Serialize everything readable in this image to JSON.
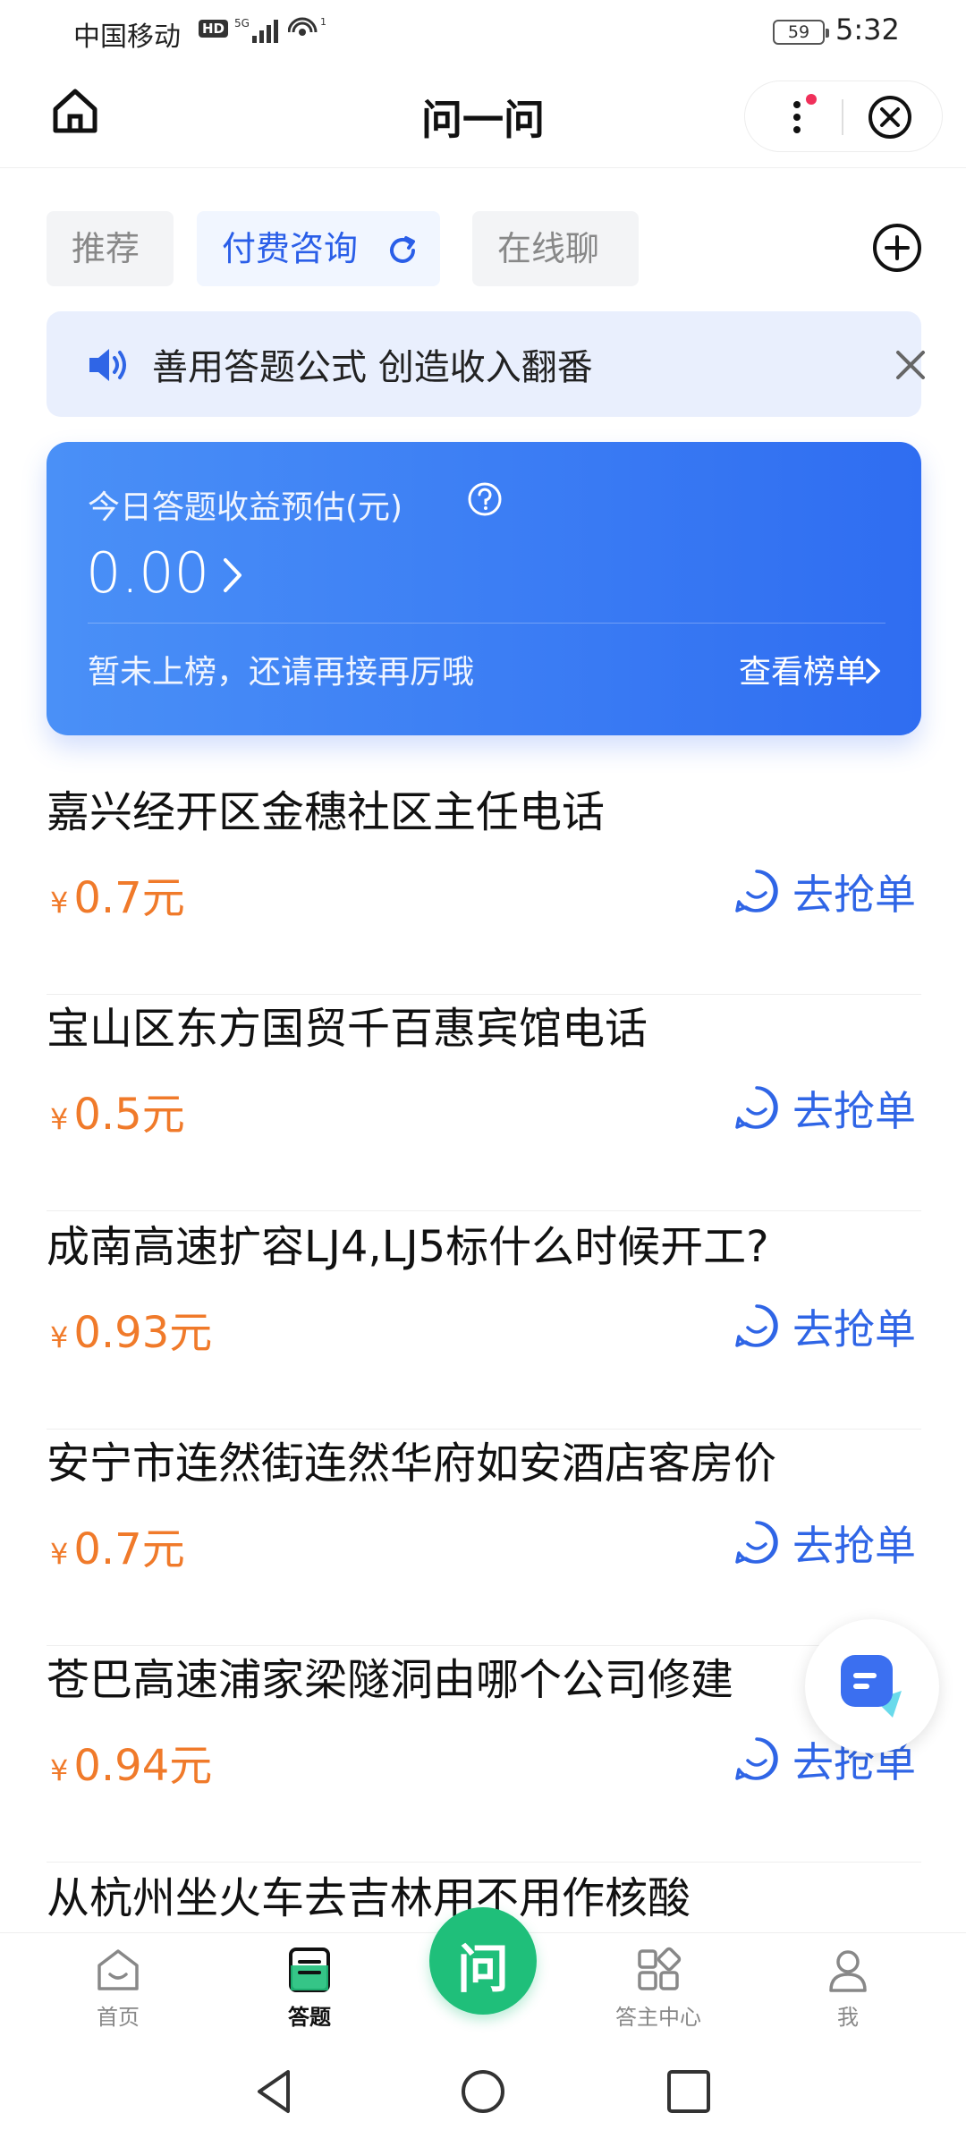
{
  "status_bar": {
    "carrier": "中国移动",
    "hd": "HD",
    "network": "5G",
    "battery": "59",
    "time": "5:32"
  },
  "header": {
    "title": "问一问"
  },
  "tabs": [
    {
      "label": "推荐"
    },
    {
      "label": "付费咨询"
    },
    {
      "label": "在线聊"
    }
  ],
  "notice": {
    "text": "善用答题公式 创造收入翻番"
  },
  "earnings": {
    "label": "今日答题收益预估(元)",
    "amount": "0.00",
    "rank_text": "暂未上榜，还请再接再厉哦",
    "view_rank": "查看榜单"
  },
  "questions": [
    {
      "title": "嘉兴经开区金穗社区主任电话",
      "price": "0.7元",
      "action": "去抢单"
    },
    {
      "title": "宝山区东方国贸千百惠宾馆电话",
      "price": "0.5元",
      "action": "去抢单"
    },
    {
      "title": "成南高速扩容LJ4,LJ5标什么时候开工?",
      "price": "0.93元",
      "action": "去抢单"
    },
    {
      "title": "安宁市连然街连然华府如安酒店客房价",
      "price": "0.7元",
      "action": "去抢单"
    },
    {
      "title": "苍巴高速浦家梁隧洞由哪个公司修建",
      "price": "0.94元",
      "action": "去抢单"
    },
    {
      "title": "从杭州坐火车去吉林用不用作核酸"
    }
  ],
  "currency_symbol": "¥",
  "bottom_nav": {
    "home": "首页",
    "answer": "答题",
    "center": "问",
    "host_center": "答主中心",
    "me": "我"
  },
  "colors": {
    "accent_blue": "#2f65e6",
    "price_orange": "#f07a2a",
    "center_green": "#1fbf7a",
    "card_gradient_start": "#4a90f7",
    "card_gradient_end": "#2f6df1"
  }
}
